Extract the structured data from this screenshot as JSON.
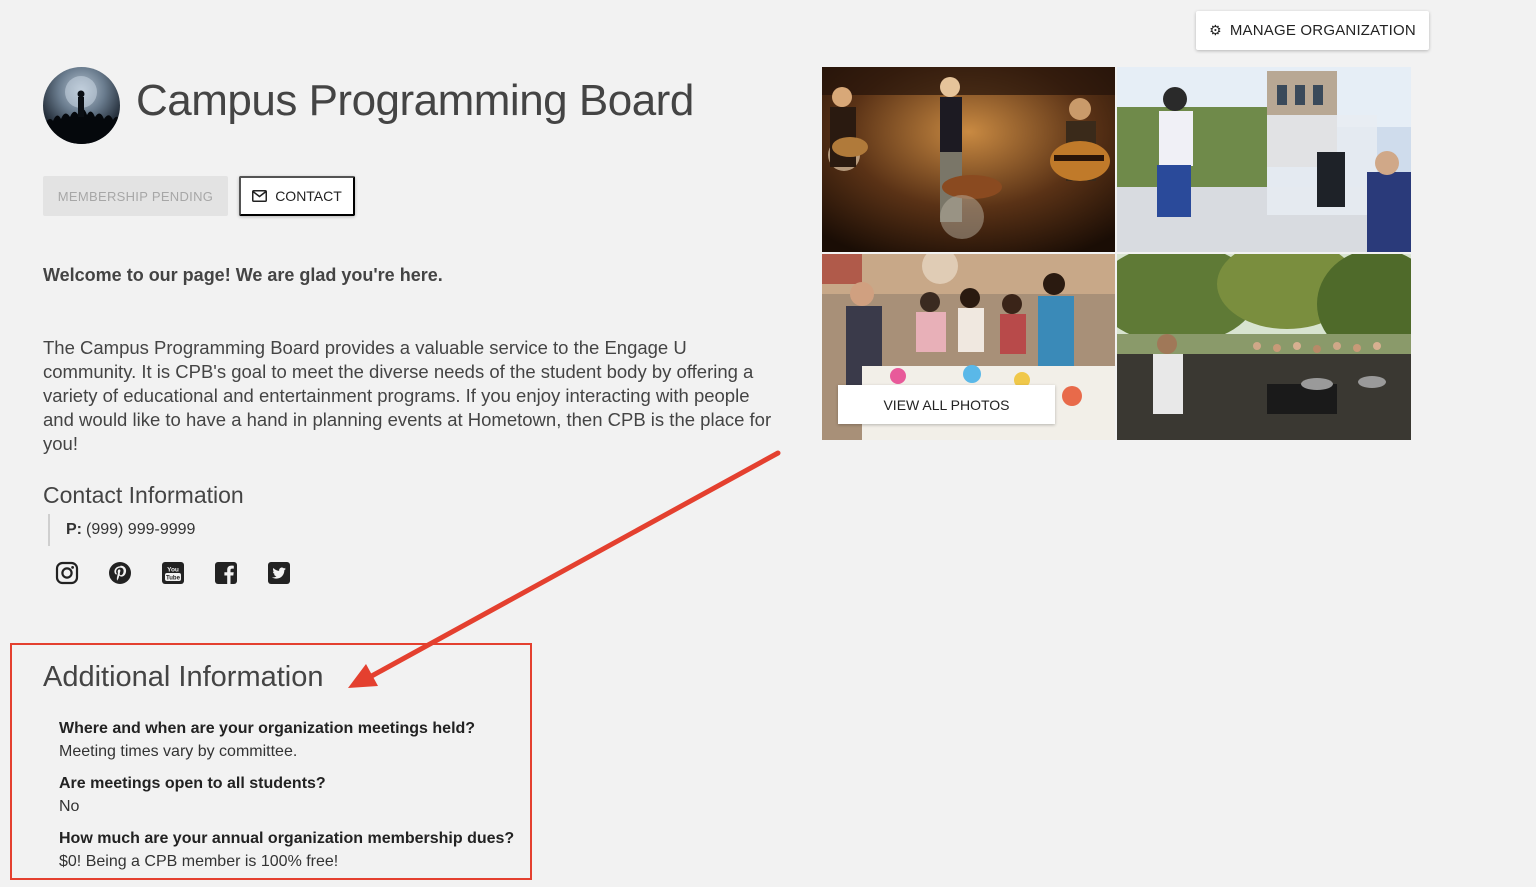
{
  "header": {
    "manage_label": "MANAGE ORGANIZATION",
    "manage_icon": "gear-icon"
  },
  "organization": {
    "name": "Campus Programming Board"
  },
  "actions": {
    "membership_label": "MEMBERSHIP PENDING",
    "contact_label": "CONTACT"
  },
  "about": {
    "welcome": "Welcome to our page! We are glad you're here.",
    "description": "The Campus Programming Board provides a valuable service to the Engage U community. It is CPB's goal to meet the diverse needs of the student body by offering a variety of educational and entertainment programs. If you enjoy interacting with people and would like to have a hand in planning events at Hometown, then CPB is the place for you!"
  },
  "contact": {
    "heading": "Contact Information",
    "phone_label": "P:",
    "phone": "(999) 999-9999",
    "social": [
      "instagram-icon",
      "pinterest-icon",
      "youtube-icon",
      "facebook-icon",
      "twitter-icon"
    ]
  },
  "gallery": {
    "view_all_label": "VIEW ALL PHOTOS"
  },
  "additional": {
    "heading": "Additional Information",
    "items": [
      {
        "question": "Where and when are your organization meetings held?",
        "answer": "Meeting times vary by committee."
      },
      {
        "question": "Are meetings open to all students?",
        "answer": "No"
      },
      {
        "question": "How much are your annual organization membership dues?",
        "answer": "$0! Being a CPB member is 100% free!"
      }
    ]
  },
  "colors": {
    "background": "#f2f2f2",
    "annotation_red": "#e4402f",
    "pending_bg": "#e3e3e3"
  }
}
